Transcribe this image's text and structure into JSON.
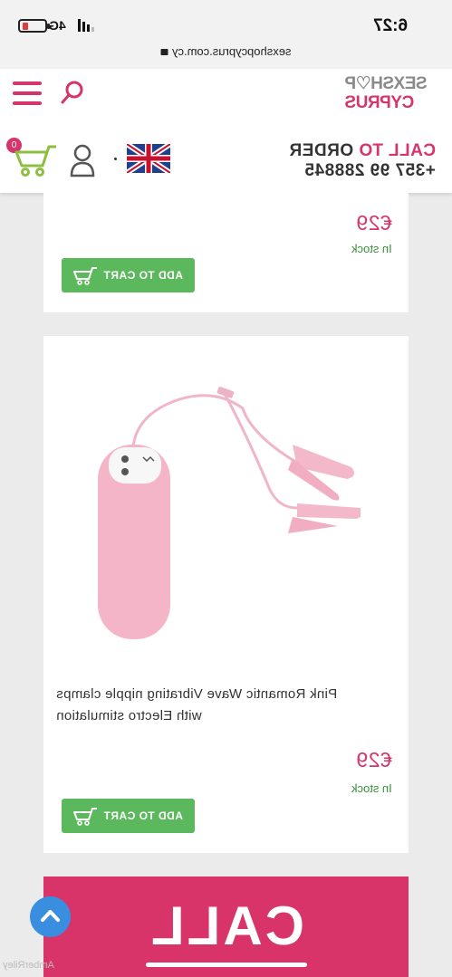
{
  "status_bar": {
    "time": "6:27",
    "network": "4G"
  },
  "browser": {
    "url": "sexshopcyprus.com.cy"
  },
  "header": {
    "logo_line1": "SEXSH♡P",
    "logo_line2": "CYPRUS",
    "call_to_order_prefix": "CALL TO",
    "call_to_order_suffix": "ORDER",
    "phone": "+357 99 288845",
    "cart_count": "0",
    "language": "English"
  },
  "products": [
    {
      "price": "€29",
      "stock": "In stock",
      "button_label": "ADD TO CART"
    },
    {
      "title_line1": "Pink Romantic Wave Vibrating nipple clamps",
      "title_line2": "with Electro stimulation",
      "price": "€29",
      "stock": "In stock",
      "button_label": "ADD TO CART"
    }
  ],
  "call_banner": {
    "text": "CALL"
  },
  "watermark": "AmberRiley",
  "colors": {
    "brand_pink": "#d5346c",
    "cart_green": "#5cb85c",
    "scroll_blue": "#3a8ee0"
  },
  "icons": [
    "menu-icon",
    "search-icon",
    "cart-icon",
    "user-icon",
    "flag-uk-icon",
    "lock-icon",
    "chevron-up-icon"
  ]
}
